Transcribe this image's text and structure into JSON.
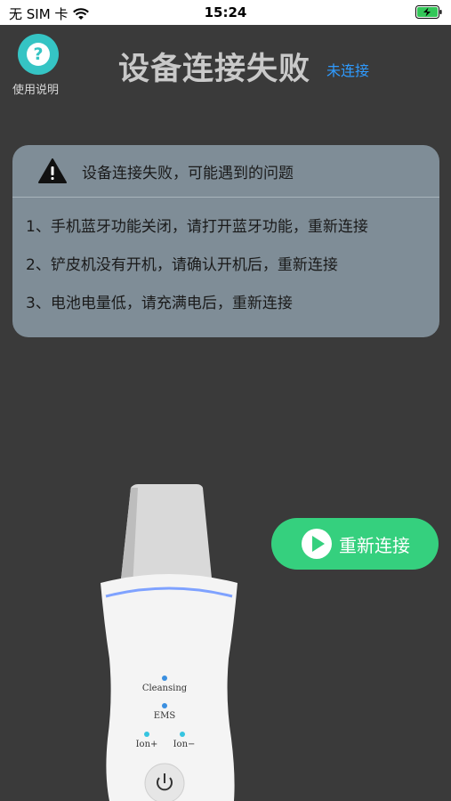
{
  "status_bar": {
    "carrier": "无 SIM 卡",
    "time": "15:24",
    "wifi_icon": "wifi-icon",
    "battery_icon": "battery-charging-icon"
  },
  "header": {
    "help_icon": "question-icon",
    "help_label": "使用说明",
    "title": "设备连接失败",
    "status": "未连接"
  },
  "info_card": {
    "warning_icon": "warning-icon",
    "title": "设备连接失败，可能遇到的问题",
    "items": [
      "1、手机蓝牙功能关闭，请打开蓝牙功能，重新连接",
      "2、铲皮机没有开机，请确认开机后，重新连接",
      "3、电池电量低，请充满电后，重新连接"
    ]
  },
  "device": {
    "modes": [
      "Cleansing",
      "EMS",
      "Ion+",
      "Ion−"
    ],
    "power_icon": "power-icon"
  },
  "reconnect_button": {
    "label": "重新连接",
    "icon": "play-icon"
  },
  "colors": {
    "background": "#3a3a3a",
    "card": "#7f8d97",
    "accent_green": "#35d07e",
    "help_teal": "#35c4c4",
    "link_blue": "#2f9bff"
  }
}
